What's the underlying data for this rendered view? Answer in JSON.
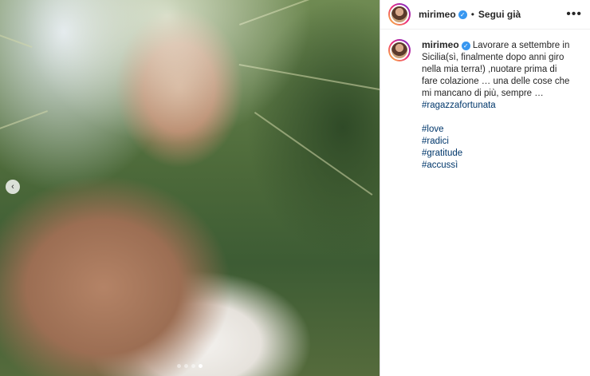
{
  "header": {
    "username": "mirimeo",
    "separator": "•",
    "follow_label": "Segui già",
    "more_label": "•••"
  },
  "caption": {
    "username": "mirimeo",
    "text": "Lavorare a settembre in Sicilia(sì, finalmente dopo anni giro nella mia terra!) ,nuotare prima di fare colazione … una delle cose che mi mancano di più, sempre …",
    "hashtag_inline": "#ragazzafortunata",
    "hashtags": [
      "#love",
      "#radici",
      "#gratitude",
      "#accussì"
    ]
  },
  "carousel": {
    "slides_total": 4,
    "active_index": 3,
    "prev_label": "‹"
  },
  "colors": {
    "verified": "#3897f0",
    "hashtag": "#00376b",
    "avatar_ring": [
      "#f9ce34",
      "#ee2a7b",
      "#6228d7"
    ]
  },
  "icons": {
    "verified": "verified-badge-icon",
    "more": "more-options-icon",
    "prev": "chevron-left-icon"
  }
}
